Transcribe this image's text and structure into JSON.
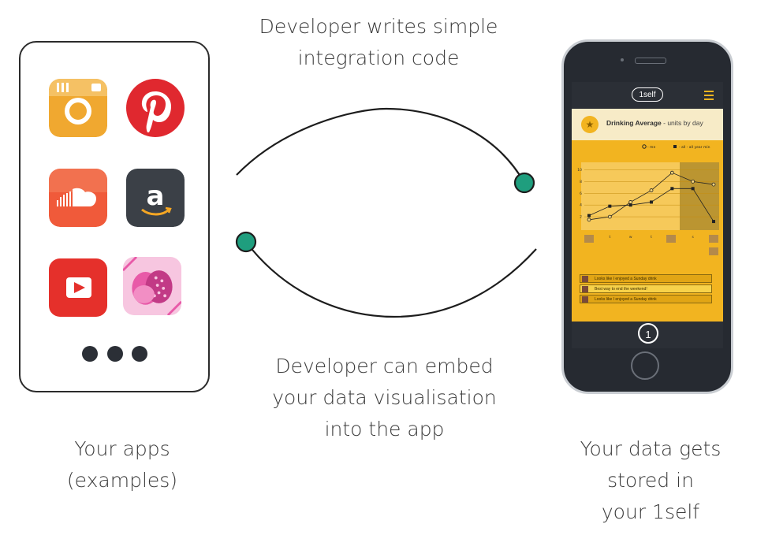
{
  "captions": {
    "top": [
      "Developer writes simple",
      "integration code"
    ],
    "middle": [
      "Developer can embed",
      "your data visualisation",
      "into the app"
    ],
    "left": [
      "Your apps",
      "(examples)"
    ],
    "right": [
      "Your data gets",
      "stored in",
      "your 1self"
    ]
  },
  "colors": {
    "accent": "#f2b420",
    "connector_dot": "#1f9e7e",
    "instagram": "#f0a830",
    "pinterest": "#e0282f",
    "soundcloud": "#f05a3a",
    "amazon": "#3b4047",
    "youtube": "#e5302b",
    "candy": "#e85aa8"
  },
  "apps": [
    {
      "name": "instagram",
      "icon": "camera-icon"
    },
    {
      "name": "pinterest",
      "icon": "pinterest-icon"
    },
    {
      "name": "soundcloud",
      "icon": "soundcloud-icon"
    },
    {
      "name": "amazon",
      "icon": "amazon-icon",
      "glyph": "a"
    },
    {
      "name": "youtube",
      "icon": "play-icon"
    },
    {
      "name": "candy",
      "icon": "candy-icon"
    }
  ],
  "phone_app": {
    "logo": "1self",
    "chart_title": "Drinking Average",
    "chart_subtitle": "- units by day",
    "legend_me": "- me",
    "legend_all": "- all - all year min",
    "footer_badge": "1",
    "feed": [
      "Looks like I enjoyed a Sunday drink",
      "Best way to end the weekend!",
      "Looks like I enjoyed a Sunday drink"
    ]
  },
  "chart_data": {
    "type": "line",
    "categories": [
      "m",
      "t",
      "w",
      "t",
      "f",
      "s",
      "s"
    ],
    "yticks": [
      "2",
      "4",
      "6",
      "8",
      "10"
    ],
    "ylim": [
      0,
      11
    ],
    "series": [
      {
        "values": [
          1.5,
          2,
          4.5,
          6.5,
          9.5,
          8,
          7.5
        ],
        "marker": "circle"
      },
      {
        "values": [
          2.2,
          3.8,
          4,
          4.5,
          6.8,
          6.8,
          1.2
        ],
        "marker": "square"
      }
    ]
  }
}
